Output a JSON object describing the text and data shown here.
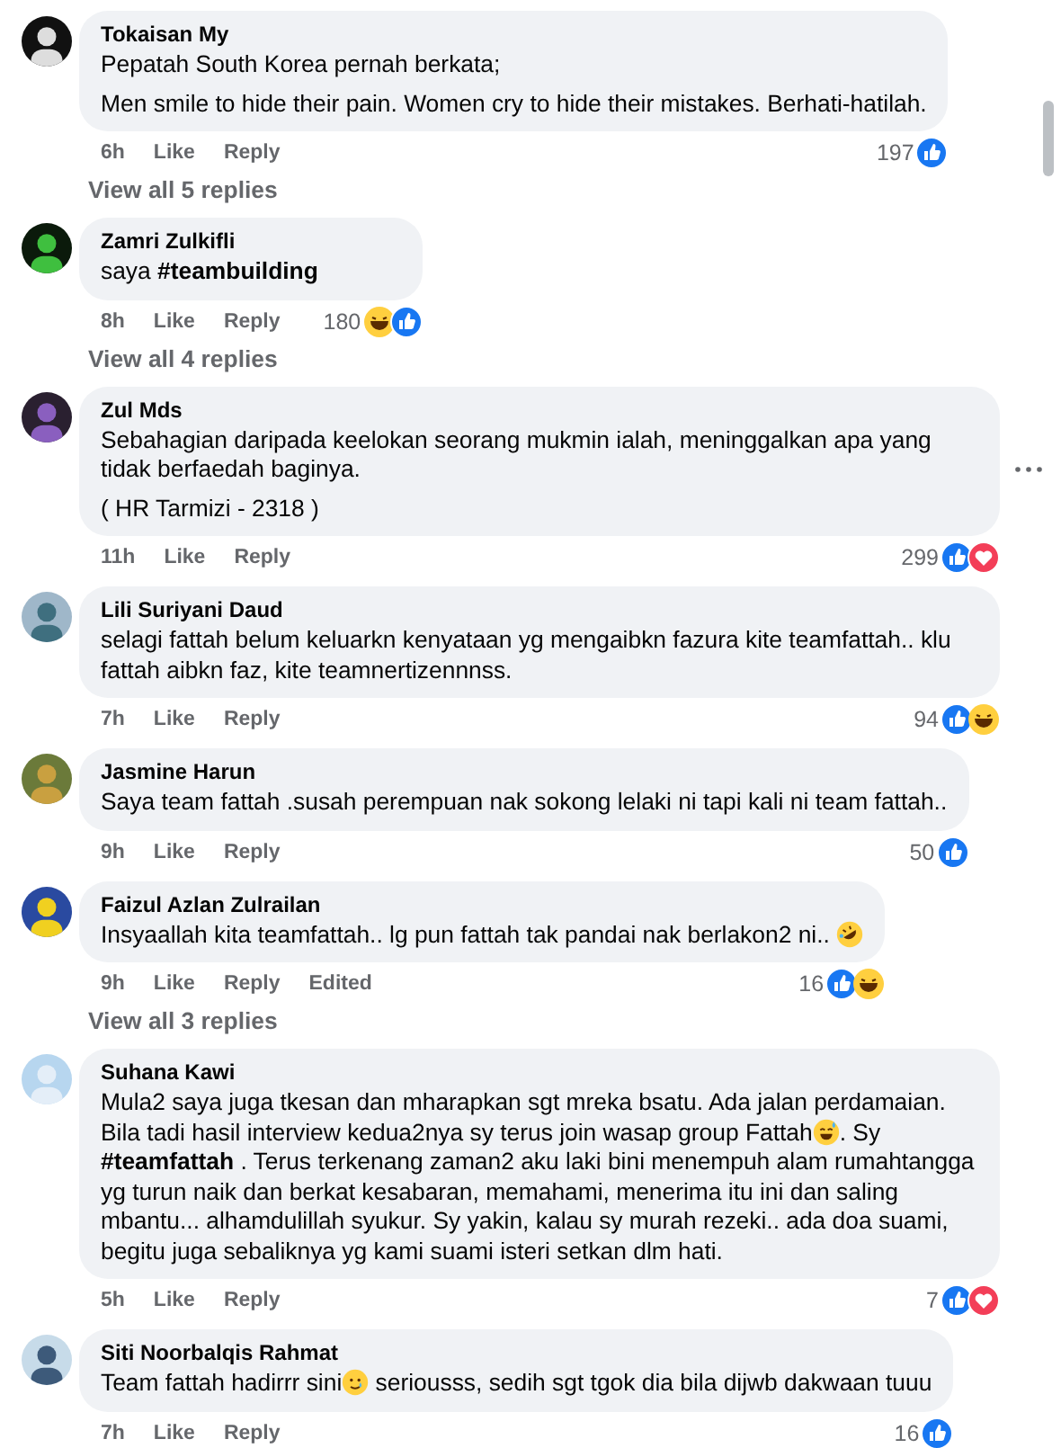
{
  "comments": [
    {
      "author": "Tokaisan My",
      "paragraphs": [
        [
          {
            "text": "Pepatah South Korea pernah berkata;"
          }
        ],
        [
          {
            "text": "Men smile to hide their pain. Women cry to hide their mistakes. Berhati-hatilah."
          }
        ]
      ],
      "time": "6h",
      "actions": [
        "Like",
        "Reply"
      ],
      "count": "197",
      "reactions": [
        {
          "kind": "like"
        }
      ],
      "replies_link": "View all 5 replies"
    },
    {
      "author": "Zamri Zulkifli",
      "paragraphs": [
        [
          {
            "text": "saya **#teambuilding**"
          }
        ]
      ],
      "time": "8h",
      "actions": [
        "Like",
        "Reply"
      ],
      "count": "180",
      "reactions": [
        {
          "kind": "haha"
        },
        {
          "kind": "like"
        }
      ],
      "replies_link": "View all 4 replies"
    },
    {
      "author": "Zul Mds",
      "paragraphs": [
        [
          {
            "text": "Sebahagian daripada keelokan seorang mukmin ialah, meninggalkan apa yang tidak berfaedah baginya."
          }
        ],
        [
          {
            "text": "( HR Tarmizi - 2318 )"
          }
        ]
      ],
      "time": "11h",
      "actions": [
        "Like",
        "Reply"
      ],
      "count": "299",
      "reactions": [
        {
          "kind": "like"
        },
        {
          "kind": "love"
        }
      ],
      "more_button": true
    },
    {
      "author": "Lili Suriyani Daud",
      "paragraphs": [
        [
          {
            "text": "selagi fattah belum keluarkn kenyataan yg mengaibkn fazura kite teamfattah.. klu fattah aibkn faz, kite teamnertizennnss."
          }
        ]
      ],
      "time": "7h",
      "actions": [
        "Like",
        "Reply"
      ],
      "count": "94",
      "reactions": [
        {
          "kind": "like"
        },
        {
          "kind": "haha"
        }
      ]
    },
    {
      "author": "Jasmine Harun",
      "paragraphs": [
        [
          {
            "text": "Saya team fattah .susah perempuan nak sokong lelaki ni tapi kali ni team fattah.."
          }
        ]
      ],
      "time": "9h",
      "actions": [
        "Like",
        "Reply"
      ],
      "count": "50",
      "reactions": [
        {
          "kind": "like"
        }
      ]
    },
    {
      "author": "Faizul Azlan Zulrailan",
      "paragraphs": [
        [
          {
            "text": "Insyaallah kita teamfattah.. lg pun fattah tak pandai nak berlakon2 ni.. "
          },
          {
            "kind": "rolling-laugh"
          }
        ]
      ],
      "time": "9h",
      "actions": [
        "Like",
        "Reply"
      ],
      "edited": "Edited",
      "count": "16",
      "reactions": [
        {
          "kind": "like"
        },
        {
          "kind": "haha"
        }
      ],
      "replies_link": "View all 3 replies"
    },
    {
      "author": "Suhana Kawi",
      "paragraphs": [
        [
          {
            "text": "Mula2 saya juga tkesan dan mharapkan sgt mreka bsatu. Ada jalan perdamaian. Bila tadi hasil interview kedua2nya sy terus join wasap group Fattah"
          },
          {
            "kind": "sweat-smile"
          },
          {
            "text": ". Sy **#teamfattah** . Terus terkenang zaman2 aku laki bini menempuh alam rumahtangga yg turun naik dan berkat kesabaran, memahami, menerima itu ini dan saling mbantu... alhamdulillah syukur. Sy yakin, kalau sy murah rezeki.. ada doa suami, begitu juga sebaliknya yg kami suami isteri setkan dlm hati."
          }
        ]
      ],
      "time": "5h",
      "actions": [
        "Like",
        "Reply"
      ],
      "count": "7",
      "reactions": [
        {
          "kind": "like"
        },
        {
          "kind": "love"
        }
      ]
    },
    {
      "author": "Siti Noorbalqis Rahmat",
      "paragraphs": [
        [
          {
            "text": "Team fattah hadirrr sini"
          },
          {
            "kind": "tear-smile"
          },
          {
            "text": " seriousss, sedih sgt tgok dia bila dijwb dakwaan tuuu"
          }
        ]
      ],
      "time": "7h",
      "actions": [
        "Like",
        "Reply"
      ],
      "count": "16",
      "reactions": [
        {
          "kind": "like"
        }
      ]
    }
  ]
}
